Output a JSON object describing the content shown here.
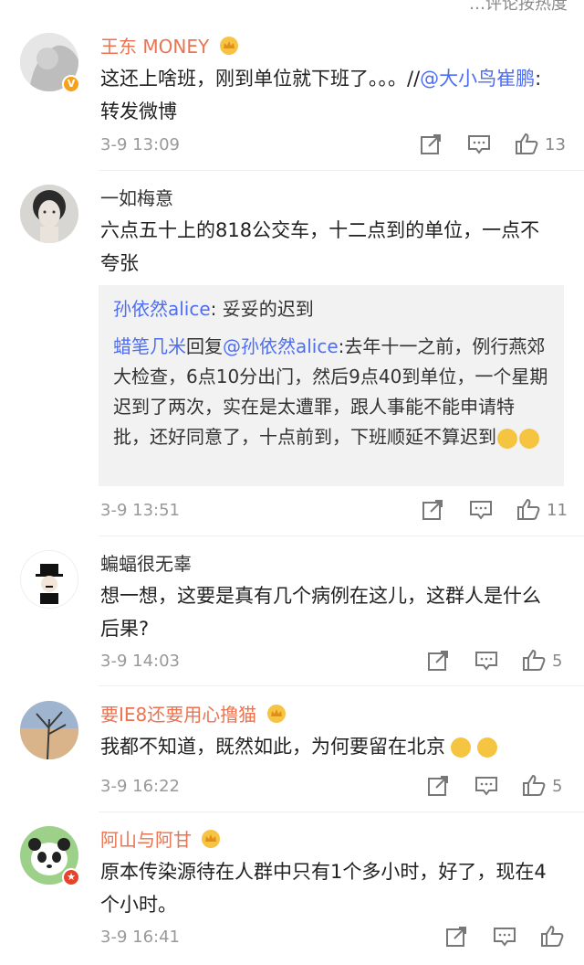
{
  "top_partial": "…评论按热度",
  "comments": [
    {
      "username": "王东 MONEY",
      "vip": true,
      "badge": "V",
      "text_prefix": "这还上啥班，刚到单位就下班了。。。//",
      "mention": "@大小鸟崔鹏",
      "text_suffix": ": 转发微博",
      "time": "3-9 13:09",
      "likes": "13"
    },
    {
      "username": "一如梅意",
      "vip": false,
      "text": "六点五十上的818公交车，十二点到的单位，一点不夸张",
      "quote": {
        "line1_name": "孙依然alice",
        "line1_text": ": 妥妥的迟到",
        "line2_name": "蜡笔几米",
        "line2_mid": "回复",
        "line2_mention": "@孙依然alice",
        "line2_text": ":去年十一之前，例行燕郊大检查，6点10分出门，然后9点40到单位，一个星期迟到了两次，实在是太遭罪，跟人事能不能申请特批，还好同意了，十点前到，下班顺延不算迟到"
      },
      "time": "3-9 13:51",
      "likes": "11"
    },
    {
      "username": "蝙蝠很无辜",
      "vip": false,
      "text": "想一想，这要是真有几个病例在这儿，这群人是什么后果?",
      "time": "3-9 14:03",
      "likes": "5"
    },
    {
      "username": "要IE8还要用心撸猫",
      "vip": true,
      "text": "我都不知道，既然如此，为何要留在北京",
      "time": "3-9 16:22",
      "likes": "5"
    },
    {
      "username": "阿山与阿甘",
      "vip": true,
      "badge": "★",
      "text": "原本传染源待在人群中只有1个多小时，好了，现在4个小时。",
      "time": "3-9 16:41",
      "likes": ""
    }
  ],
  "colors": {
    "vip_name": "#eb7350",
    "link": "#4e6ef2",
    "meta": "#999999"
  },
  "icons": [
    "share-icon",
    "comment-icon",
    "like-icon",
    "crown-icon",
    "cry-emoji",
    "smirk-emoji"
  ]
}
